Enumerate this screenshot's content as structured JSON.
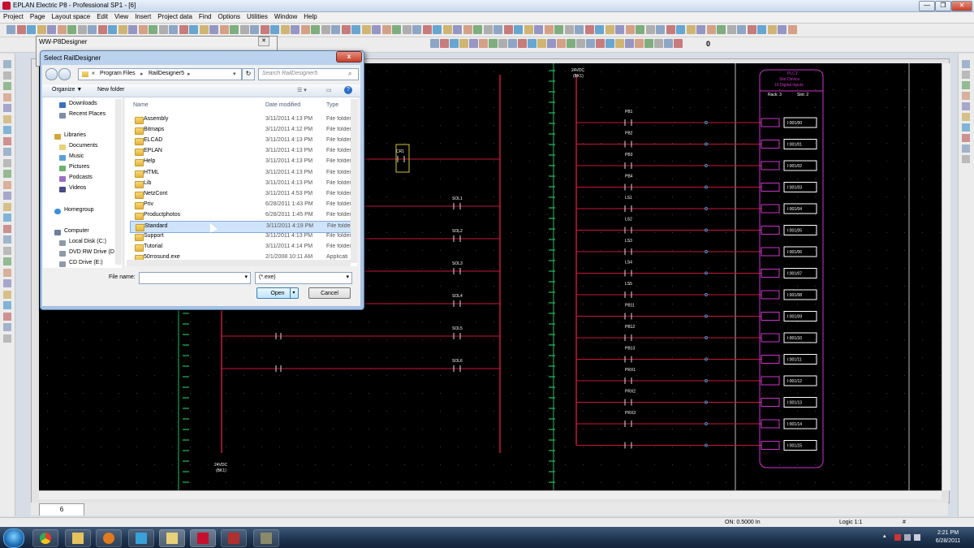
{
  "window": {
    "title": "EPLAN Electric P8 - Professional SP1 - [6]",
    "minimize": "—",
    "restore": "❐",
    "close": "✕"
  },
  "menu": [
    "Project",
    "Page",
    "Layout space",
    "Edit",
    "View",
    "Insert",
    "Project data",
    "Find",
    "Options",
    "Utilities",
    "Window",
    "Help"
  ],
  "toolbar": {
    "value_box": "0"
  },
  "panel": {
    "title": "WW-P8Designer"
  },
  "dialog": {
    "title": "Select RailDesigner",
    "close": "x",
    "address": {
      "sep": "«",
      "crumbs": [
        "Program Files",
        "RailDesigner5"
      ]
    },
    "search_placeholder": "Search RailDesigner5",
    "organize": "Organize ▼",
    "new_folder": "New folder",
    "nav": {
      "favorites": [
        "Downloads",
        "Recent Places"
      ],
      "libraries_header": "Libraries",
      "libraries": [
        "Documents",
        "Music",
        "Pictures",
        "Podcasts",
        "Videos"
      ],
      "homegroup": "Homegroup",
      "computer_header": "Computer",
      "computer": [
        "Local Disk (C:)",
        "DVD RW Drive (D",
        "CD Drive (E:)"
      ]
    },
    "columns": {
      "name": "Name",
      "date": "Date modified",
      "type": "Type"
    },
    "files": [
      {
        "name": "Assembly",
        "date": "3/11/2011 4:13 PM",
        "type": "File folder"
      },
      {
        "name": "Bitmaps",
        "date": "3/11/2011 4:12 PM",
        "type": "File folder"
      },
      {
        "name": "ELCAD",
        "date": "3/11/2011 4:13 PM",
        "type": "File folder"
      },
      {
        "name": "EPLAN",
        "date": "3/11/2011 4:13 PM",
        "type": "File folder"
      },
      {
        "name": "Help",
        "date": "3/11/2011 4:13 PM",
        "type": "File folder"
      },
      {
        "name": "HTML",
        "date": "3/11/2011 4:13 PM",
        "type": "File folder"
      },
      {
        "name": "Lib",
        "date": "3/11/2011 4:13 PM",
        "type": "File folder"
      },
      {
        "name": "NetzCont",
        "date": "3/11/2011 4:53 PM",
        "type": "File folder"
      },
      {
        "name": "Priv",
        "date": "6/28/2011 1:43 PM",
        "type": "File folder"
      },
      {
        "name": "Productphotos",
        "date": "6/28/2011 1:45 PM",
        "type": "File folder"
      },
      {
        "name": "Standard",
        "date": "3/11/2011 4:19 PM",
        "type": "File folder"
      },
      {
        "name": "Support",
        "date": "3/11/2011 4:13 PM",
        "type": "File folder"
      },
      {
        "name": "Tutorial",
        "date": "3/11/2011 4:14 PM",
        "type": "File folder"
      },
      {
        "name": "50rrosund.exe",
        "date": "2/1/2008 10:11 AM",
        "type": "Applicati"
      }
    ],
    "selected_index": 10,
    "file_name_label": "File name:",
    "file_name_value": "",
    "file_type": "(*.exe)",
    "open": "Open",
    "cancel": "Cancel"
  },
  "canvas": {
    "left_wire_labels": [
      "24VDC",
      "(BK1)"
    ],
    "coils": [
      "CR1",
      "SOL1",
      "SOL2",
      "SOL3",
      "SOL4",
      "SOL5",
      "SOL6"
    ],
    "contacts": [
      "PB1",
      "PB2",
      "PB3",
      "PB4",
      "LS1",
      "LS2",
      "LS3",
      "LS4",
      "LS5",
      "PB11",
      "PB12",
      "PB13",
      "PRX1",
      "PRX2",
      "PRX3"
    ],
    "plc_header": [
      "PLC1",
      "Slot Device",
      "16 Digital Inputs"
    ],
    "plc_rack": "Rack: 3",
    "plc_slot": "Slot: 2",
    "plc_inputs": [
      "I:001/00",
      "I:001/01",
      "I:001/02",
      "I:001/03",
      "I:001/04",
      "I:001/05",
      "I:001/06",
      "I:001/07",
      "I:001/08",
      "I:001/09",
      "I:001/10",
      "I:001/11",
      "I:001/12",
      "I:001/13",
      "I:001/14",
      "I:001/15"
    ],
    "supply_top": [
      "24VDC",
      "(BK1)"
    ]
  },
  "page_tab": "6",
  "status": {
    "grid": "ON: 0.5000 In",
    "logic": "Logic 1:1",
    "hash": "#"
  },
  "clock": {
    "time": "2:21 PM",
    "date": "6/28/2011"
  },
  "colors": {
    "wire_red": "#c8173a",
    "rung_green": "#1ec05a",
    "plc_magenta": "#cc33cc"
  }
}
